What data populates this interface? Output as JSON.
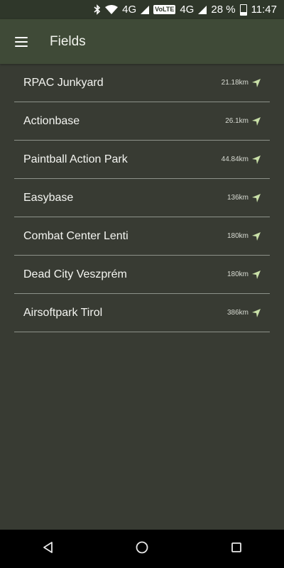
{
  "status_bar": {
    "network_a": "4G",
    "volte": "VoLTE",
    "network_b": "4G",
    "battery": "28 %",
    "time": "11:47"
  },
  "header": {
    "title": "Fields"
  },
  "fields": [
    {
      "name": "RPAC Junkyard",
      "distance": "21.18km"
    },
    {
      "name": "Actionbase",
      "distance": "26.1km"
    },
    {
      "name": "Paintball Action Park",
      "distance": "44.84km"
    },
    {
      "name": "Easybase",
      "distance": "136km"
    },
    {
      "name": "Combat Center Lenti",
      "distance": "180km"
    },
    {
      "name": "Dead City Veszprém",
      "distance": "180km"
    },
    {
      "name": "Airsoftpark Tirol",
      "distance": "386km"
    }
  ],
  "colors": {
    "background": "#383b33",
    "app_bar": "#3f4a37",
    "status_bar": "#2f372a",
    "accent_icon": "#c9e0a8"
  }
}
